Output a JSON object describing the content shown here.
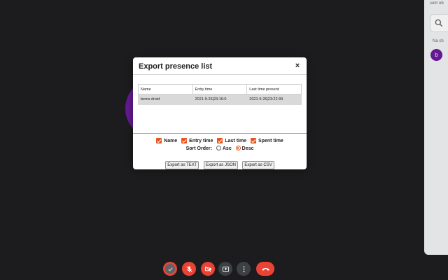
{
  "side_panel": {
    "hint_text": "som ob",
    "note_text": "Na ch",
    "avatar_letter": "b"
  },
  "modal": {
    "title": "Export presence list",
    "close_label": "×",
    "table": {
      "headers": [
        "Name",
        "Entry time",
        "Last time present"
      ],
      "rows": [
        [
          "bems droid",
          "2021-9-26|23:16:0",
          "2021-9-26|23:22:39"
        ]
      ]
    },
    "columns": [
      {
        "label": "Name",
        "checked": true
      },
      {
        "label": "Entry time",
        "checked": true
      },
      {
        "label": "Last time",
        "checked": true
      },
      {
        "label": "Spent time",
        "checked": true
      }
    ],
    "sort_order": {
      "label": "Sort Order:",
      "options": [
        "Asc",
        "Desc"
      ],
      "selected": "Desc"
    },
    "buttons": {
      "text": "Export as TEXT",
      "json": "Export as JSON",
      "csv": "Export as CSV"
    }
  },
  "controls": {
    "presence": "check-circle-icon",
    "mic": "mic-off-icon",
    "camera": "camera-off-icon",
    "present": "present-screen-icon",
    "more": "more-vertical-icon",
    "leave": "hang-up-icon"
  },
  "colors": {
    "accent": "#e8541e",
    "danger": "#ea4335",
    "avatar": "#6a1b9a"
  }
}
